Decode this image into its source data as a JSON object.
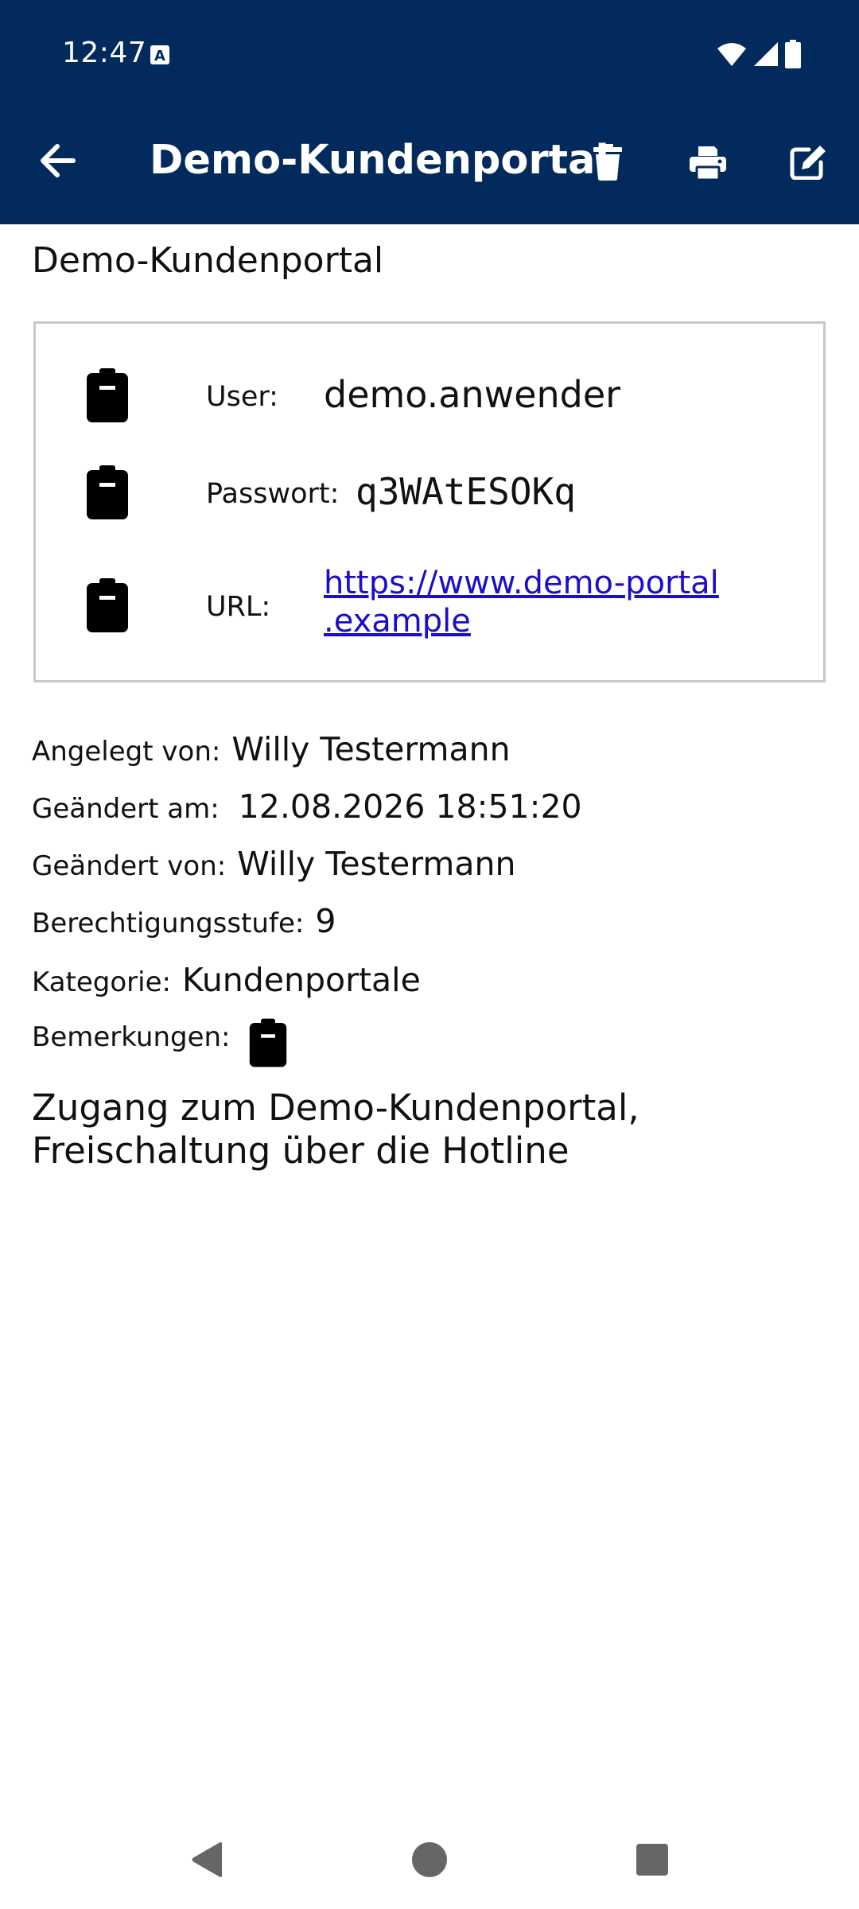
{
  "status_bar": {
    "time": "12:47",
    "icons": [
      "a-notification-icon",
      "wifi-icon",
      "signal-icon",
      "battery-icon"
    ]
  },
  "toolbar": {
    "title": "Demo-Kundenportal",
    "actions": [
      "back-arrow-icon",
      "trash-icon",
      "print-icon",
      "edit-icon"
    ]
  },
  "entry": {
    "heading": "Demo-Kundenportal",
    "credentials": {
      "user_label": "User:",
      "user_value": "demo.anwender",
      "password_label": "Passwort:",
      "password_value": "q3WAtESOKq",
      "url_label": "URL:",
      "url_line1": "https://www.demo-portal",
      "url_line2": ".example"
    },
    "meta": {
      "created_by_label": "Angelegt von:",
      "created_by_value": "Willy Testermann",
      "changed_at_label": "Geändert am:",
      "changed_at_value": "12.08.2026 18:51:20",
      "changed_by_label": "Geändert von:",
      "changed_by_value": "Willy Testermann",
      "permission_label": "Berechtigungsstufe:",
      "permission_value": "9",
      "category_label": "Kategorie:",
      "category_value": "Kundenportale",
      "remarks_label": "Bemerkungen:"
    },
    "remarks_text": "Zugang zum Demo-Kundenportal, Freischaltung über die Hotline"
  },
  "colors": {
    "appbar": "#022a5c",
    "link": "#1a0dcc",
    "box_border": "#c8c8c8"
  },
  "nav_bar": [
    "back-triangle-icon",
    "home-circle-icon",
    "recents-square-icon"
  ]
}
